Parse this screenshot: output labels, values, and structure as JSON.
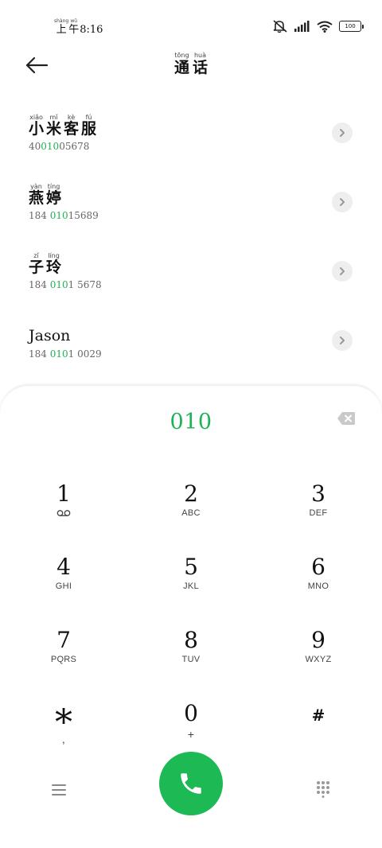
{
  "status_bar": {
    "time_prefix_chars": [
      {
        "pinyin": "shàng",
        "char": "上"
      },
      {
        "pinyin": "wǔ",
        "char": "午"
      }
    ],
    "time": "8:16",
    "battery": "100",
    "icons": [
      "mute-bell-icon",
      "signal-icon",
      "wifi-icon",
      "battery-icon"
    ]
  },
  "header": {
    "title_chars": [
      {
        "pinyin": "tōng",
        "char": "通"
      },
      {
        "pinyin": "huà",
        "char": "话"
      }
    ]
  },
  "contacts": [
    {
      "name_chars": [
        {
          "pinyin": "xiǎo",
          "char": "小"
        },
        {
          "pinyin": "mǐ",
          "char": "米"
        },
        {
          "pinyin": "kè",
          "char": "客"
        },
        {
          "pinyin": "fú",
          "char": "服"
        }
      ],
      "number_pre": "40",
      "number_hl": "010",
      "number_post": "05678"
    },
    {
      "name_chars": [
        {
          "pinyin": "yàn",
          "char": "燕"
        },
        {
          "pinyin": "tíng",
          "char": "婷"
        }
      ],
      "number_pre": "184 ",
      "number_hl": "010",
      "number_post": "15689"
    },
    {
      "name_chars": [
        {
          "pinyin": "zǐ",
          "char": "子"
        },
        {
          "pinyin": "líng",
          "char": "玲"
        }
      ],
      "number_pre": "184 ",
      "number_hl": "010",
      "number_post": "1 5678"
    },
    {
      "name": "Jason",
      "number_pre": "184 ",
      "number_hl": "010",
      "number_post": "1 0029"
    }
  ],
  "dialer": {
    "dialed_number": "010",
    "keys": [
      {
        "digit": "1",
        "letters": ""
      },
      {
        "digit": "2",
        "letters": "ABC"
      },
      {
        "digit": "3",
        "letters": "DEF"
      },
      {
        "digit": "4",
        "letters": "GHI"
      },
      {
        "digit": "5",
        "letters": "JKL"
      },
      {
        "digit": "6",
        "letters": "MNO"
      },
      {
        "digit": "7",
        "letters": "PQRS"
      },
      {
        "digit": "8",
        "letters": "TUV"
      },
      {
        "digit": "9",
        "letters": "WXYZ"
      },
      {
        "digit": "*",
        "letters": ","
      },
      {
        "digit": "0",
        "letters": "+"
      },
      {
        "digit": "#",
        "letters": ""
      }
    ]
  },
  "colors": {
    "accent_green": "#1db954",
    "highlight_green": "#1db354",
    "chevron_bg": "#eeeeee"
  }
}
